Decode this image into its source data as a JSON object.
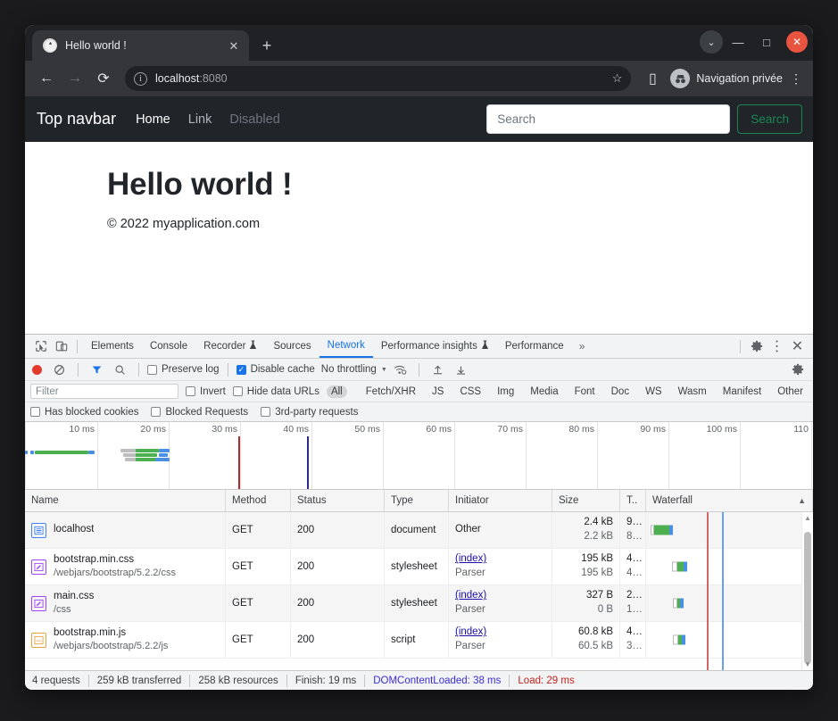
{
  "browser": {
    "tab": {
      "title": "Hello world !",
      "favicon": "globe-icon",
      "close": "✕"
    },
    "new_tab": "+",
    "window_controls": {
      "profile_arrow": "⌄",
      "minimize": "―",
      "maximize": "□",
      "close": "✕"
    },
    "nav": {
      "back": "←",
      "forward": "→",
      "reload": "⟳",
      "info": "ⓘ",
      "star": "☆",
      "sidepanel": "▯",
      "kebab": "⋮"
    },
    "address": {
      "host": "localhost",
      "port": ":8080"
    },
    "profile": {
      "label": "Navigation privée",
      "icon": "incognito-icon"
    }
  },
  "page": {
    "navbar": {
      "brand": "Top navbar",
      "links": [
        {
          "label": "Home",
          "state": "active"
        },
        {
          "label": "Link",
          "state": "normal"
        },
        {
          "label": "Disabled",
          "state": "disabled"
        }
      ],
      "search_placeholder": "Search",
      "search_value": "",
      "search_button": "Search"
    },
    "heading": "Hello world !",
    "copyright": "© 2022 myapplication.com"
  },
  "devtools": {
    "tabs": [
      {
        "label": "Elements",
        "active": false
      },
      {
        "label": "Console",
        "active": false
      },
      {
        "label": "Recorder",
        "active": false,
        "flask": true
      },
      {
        "label": "Sources",
        "active": false
      },
      {
        "label": "Network",
        "active": true
      },
      {
        "label": "Performance insights",
        "active": false,
        "flask": true
      },
      {
        "label": "Performance",
        "active": false
      }
    ],
    "more_tabs": "»",
    "icons": {
      "inspect": "inspect-icon",
      "device": "device-toggle-icon",
      "settings": "gear-icon",
      "kebab": "⋮",
      "close": "✕"
    },
    "toolbar": {
      "record": "record-button",
      "clear": "clear-button",
      "filter_icon": "filter-icon",
      "search_icon": "search-icon",
      "preserve_log": {
        "label": "Preserve log",
        "checked": false
      },
      "disable_cache": {
        "label": "Disable cache",
        "checked": true
      },
      "throttling": "No throttling",
      "wifi_icon": "network-conditions-icon",
      "import_icon": "import-har-icon",
      "export_icon": "export-har-icon",
      "settings_icon": "gear-icon"
    },
    "filterbar": {
      "placeholder": "Filter",
      "invert": {
        "label": "Invert",
        "checked": false
      },
      "hide_data_urls": {
        "label": "Hide data URLs",
        "checked": false
      },
      "types": [
        "All",
        "Fetch/XHR",
        "JS",
        "CSS",
        "Img",
        "Media",
        "Font",
        "Doc",
        "WS",
        "Wasm",
        "Manifest",
        "Other"
      ],
      "selected_type": "All"
    },
    "filterbar2": [
      {
        "label": "Has blocked cookies",
        "checked": false
      },
      {
        "label": "Blocked Requests",
        "checked": false
      },
      {
        "label": "3rd-party requests",
        "checked": false
      }
    ],
    "overview": {
      "ticks": [
        "10 ms",
        "20 ms",
        "30 ms",
        "40 ms",
        "50 ms",
        "60 ms",
        "70 ms",
        "80 ms",
        "90 ms",
        "100 ms",
        "110"
      ],
      "dom_content_loaded_ms": 38,
      "load_ms": 29
    },
    "columns": [
      "Name",
      "Method",
      "Status",
      "Type",
      "Initiator",
      "Size",
      "T..",
      "Waterfall"
    ],
    "sort_indicator": "▲",
    "requests": [
      {
        "icon": "document-icon",
        "name": "localhost",
        "path": "",
        "method": "GET",
        "status": "200",
        "type": "document",
        "initiator": "Other",
        "initiator_sub": "",
        "initiator_link": false,
        "size": "2.4 kB",
        "size_sub": "2.2 kB",
        "time": "9…",
        "time_sub": "8…"
      },
      {
        "icon": "stylesheet-icon",
        "name": "bootstrap.min.css",
        "path": "/webjars/bootstrap/5.2.2/css",
        "method": "GET",
        "status": "200",
        "type": "stylesheet",
        "initiator": "(index)",
        "initiator_sub": "Parser",
        "initiator_link": true,
        "size": "195 kB",
        "size_sub": "195 kB",
        "time": "4…",
        "time_sub": "4…"
      },
      {
        "icon": "stylesheet-icon",
        "name": "main.css",
        "path": "/css",
        "method": "GET",
        "status": "200",
        "type": "stylesheet",
        "initiator": "(index)",
        "initiator_sub": "Parser",
        "initiator_link": true,
        "size": "327 B",
        "size_sub": "0 B",
        "time": "2…",
        "time_sub": "1…"
      },
      {
        "icon": "script-icon",
        "name": "bootstrap.min.js",
        "path": "/webjars/bootstrap/5.2.2/js",
        "method": "GET",
        "status": "200",
        "type": "script",
        "initiator": "(index)",
        "initiator_sub": "Parser",
        "initiator_link": true,
        "size": "60.8 kB",
        "size_sub": "60.5 kB",
        "time": "4…",
        "time_sub": "3…"
      }
    ],
    "statusbar": {
      "requests": "4 requests",
      "transferred": "259 kB transferred",
      "resources": "258 kB resources",
      "finish": "Finish: 19 ms",
      "dom_content_loaded": "DOMContentLoaded: 38 ms",
      "load": "Load: 29 ms"
    }
  },
  "colors": {
    "accent_blue": "#1a73e8",
    "record_red": "#e23b2e",
    "success_green": "#198754",
    "waterfall_green": "#4caf50",
    "waterfall_blue": "#4a90e2",
    "event_red": "#d06666",
    "event_blue": "#6aa0e8"
  }
}
